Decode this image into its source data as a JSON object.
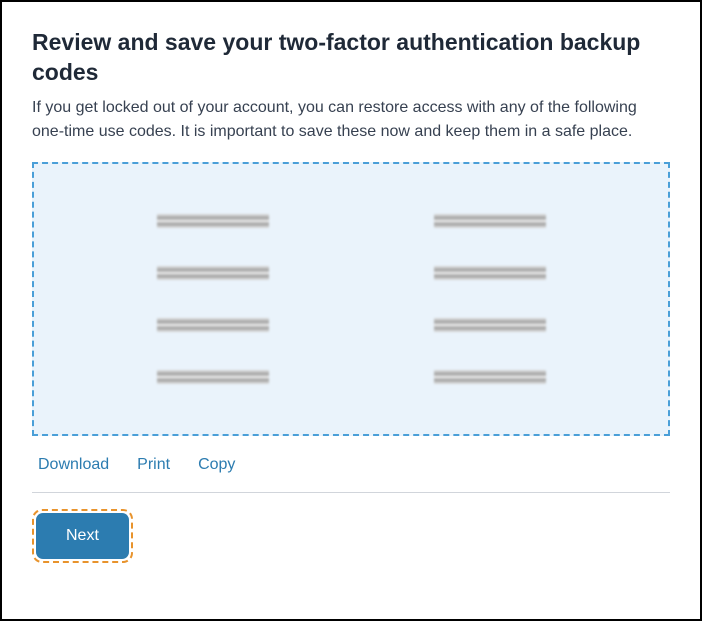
{
  "header": {
    "title": "Review and save your two-factor authentication backup codes",
    "description": "If you get locked out of your account, you can restore access with any of the following one-time use codes. It is important to save these now and keep them in a safe place."
  },
  "codes": {
    "left": [
      "",
      "",
      "",
      ""
    ],
    "right": [
      "",
      "",
      "",
      ""
    ]
  },
  "actions": {
    "download": "Download",
    "print": "Print",
    "copy": "Copy"
  },
  "footer": {
    "next": "Next"
  }
}
